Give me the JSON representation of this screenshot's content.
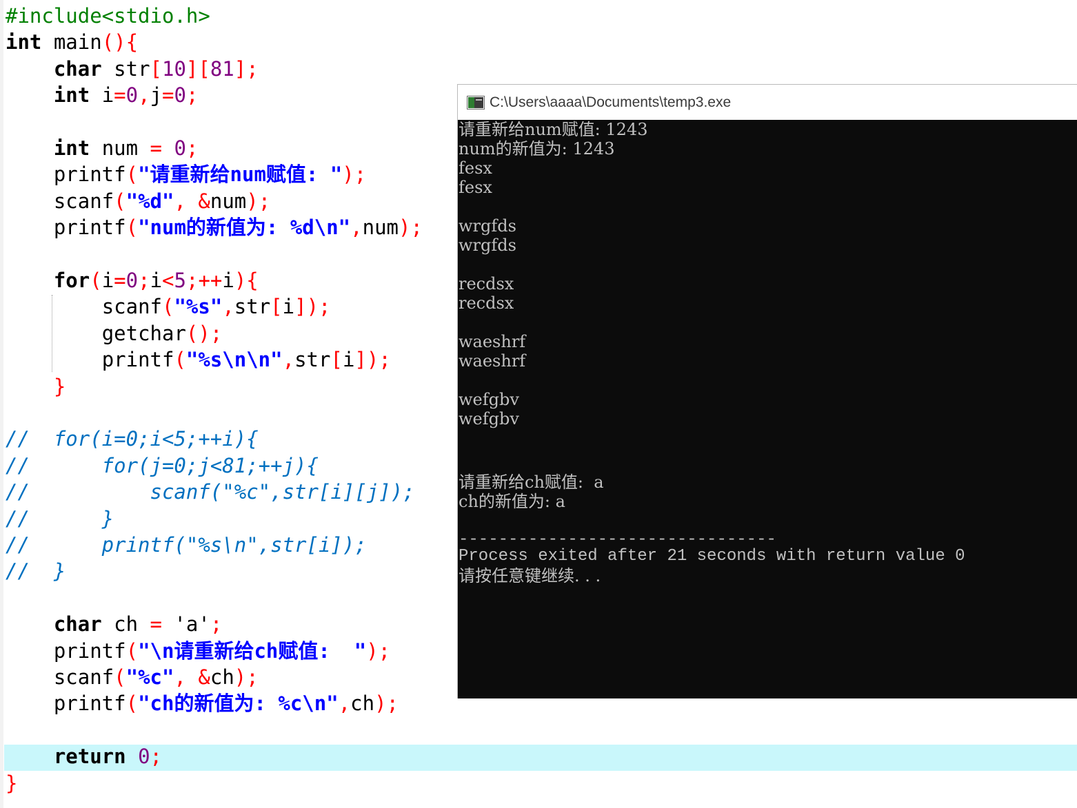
{
  "editor": {
    "lines": [
      {
        "tokens": [
          {
            "t": "#include<stdio.h>",
            "c": "pp"
          }
        ]
      },
      {
        "tokens": [
          {
            "t": "int",
            "c": "kw"
          },
          {
            "t": " main",
            "c": "id"
          },
          {
            "t": "(){",
            "c": "br"
          }
        ]
      },
      {
        "tokens": [
          {
            "t": "    "
          },
          {
            "t": "char",
            "c": "kw"
          },
          {
            "t": " str",
            "c": "id"
          },
          {
            "t": "[",
            "c": "br"
          },
          {
            "t": "10",
            "c": "num"
          },
          {
            "t": "][",
            "c": "br"
          },
          {
            "t": "81",
            "c": "num"
          },
          {
            "t": "];",
            "c": "br"
          }
        ]
      },
      {
        "tokens": [
          {
            "t": "    "
          },
          {
            "t": "int",
            "c": "kw"
          },
          {
            "t": " i",
            "c": "id"
          },
          {
            "t": "=",
            "c": "br"
          },
          {
            "t": "0",
            "c": "num"
          },
          {
            "t": ",",
            "c": "br"
          },
          {
            "t": "j",
            "c": "id"
          },
          {
            "t": "=",
            "c": "br"
          },
          {
            "t": "0",
            "c": "num"
          },
          {
            "t": ";",
            "c": "br"
          }
        ]
      },
      {
        "tokens": []
      },
      {
        "tokens": [
          {
            "t": "    "
          },
          {
            "t": "int",
            "c": "kw"
          },
          {
            "t": " num ",
            "c": "id"
          },
          {
            "t": "=",
            "c": "br"
          },
          {
            "t": " "
          },
          {
            "t": "0",
            "c": "num"
          },
          {
            "t": ";",
            "c": "br"
          }
        ]
      },
      {
        "tokens": [
          {
            "t": "    "
          },
          {
            "t": "printf",
            "c": "id"
          },
          {
            "t": "(",
            "c": "br"
          },
          {
            "t": "\"请重新给num赋值: \"",
            "c": "str"
          },
          {
            "t": ");",
            "c": "br"
          }
        ]
      },
      {
        "tokens": [
          {
            "t": "    "
          },
          {
            "t": "scanf",
            "c": "id"
          },
          {
            "t": "(",
            "c": "br"
          },
          {
            "t": "\"%d\"",
            "c": "str"
          },
          {
            "t": ",",
            "c": "br"
          },
          {
            "t": " "
          },
          {
            "t": "&",
            "c": "br"
          },
          {
            "t": "num",
            "c": "id"
          },
          {
            "t": ");",
            "c": "br"
          }
        ]
      },
      {
        "tokens": [
          {
            "t": "    "
          },
          {
            "t": "printf",
            "c": "id"
          },
          {
            "t": "(",
            "c": "br"
          },
          {
            "t": "\"num的新值为: %d\\n\"",
            "c": "str"
          },
          {
            "t": ",",
            "c": "br"
          },
          {
            "t": "num",
            "c": "id"
          },
          {
            "t": ");",
            "c": "br"
          }
        ]
      },
      {
        "tokens": []
      },
      {
        "tokens": [
          {
            "t": "    "
          },
          {
            "t": "for",
            "c": "kw"
          },
          {
            "t": "(",
            "c": "br"
          },
          {
            "t": "i",
            "c": "id"
          },
          {
            "t": "=",
            "c": "br"
          },
          {
            "t": "0",
            "c": "num"
          },
          {
            "t": ";",
            "c": "br"
          },
          {
            "t": "i",
            "c": "id"
          },
          {
            "t": "<",
            "c": "br"
          },
          {
            "t": "5",
            "c": "num"
          },
          {
            "t": ";++",
            "c": "br"
          },
          {
            "t": "i",
            "c": "id"
          },
          {
            "t": "){",
            "c": "br"
          }
        ]
      },
      {
        "tokens": [
          {
            "t": "        "
          },
          {
            "t": "scanf",
            "c": "id"
          },
          {
            "t": "(",
            "c": "br"
          },
          {
            "t": "\"%s\"",
            "c": "str"
          },
          {
            "t": ",",
            "c": "br"
          },
          {
            "t": "str",
            "c": "id"
          },
          {
            "t": "[",
            "c": "br"
          },
          {
            "t": "i",
            "c": "id"
          },
          {
            "t": "]);",
            "c": "br"
          }
        ]
      },
      {
        "tokens": [
          {
            "t": "        "
          },
          {
            "t": "getchar",
            "c": "id"
          },
          {
            "t": "();",
            "c": "br"
          }
        ]
      },
      {
        "tokens": [
          {
            "t": "        "
          },
          {
            "t": "printf",
            "c": "id"
          },
          {
            "t": "(",
            "c": "br"
          },
          {
            "t": "\"%s\\n\\n\"",
            "c": "str"
          },
          {
            "t": ",",
            "c": "br"
          },
          {
            "t": "str",
            "c": "id"
          },
          {
            "t": "[",
            "c": "br"
          },
          {
            "t": "i",
            "c": "id"
          },
          {
            "t": "]);",
            "c": "br"
          }
        ]
      },
      {
        "tokens": [
          {
            "t": "    "
          },
          {
            "t": "}",
            "c": "br"
          }
        ]
      },
      {
        "tokens": []
      },
      {
        "tokens": [
          {
            "t": "//  for(i=0;i<5;++i){",
            "c": "cm"
          }
        ]
      },
      {
        "tokens": [
          {
            "t": "//      for(j=0;j<81;++j){",
            "c": "cm"
          }
        ]
      },
      {
        "tokens": [
          {
            "t": "//          scanf(\"%c\",str[i][j]);",
            "c": "cm"
          }
        ]
      },
      {
        "tokens": [
          {
            "t": "//      }",
            "c": "cm"
          }
        ]
      },
      {
        "tokens": [
          {
            "t": "//      printf(\"%s\\n\",str[i]);",
            "c": "cm"
          }
        ]
      },
      {
        "tokens": [
          {
            "t": "//  }",
            "c": "cm"
          }
        ]
      },
      {
        "tokens": []
      },
      {
        "tokens": [
          {
            "t": "    "
          },
          {
            "t": "char",
            "c": "kw"
          },
          {
            "t": " ch ",
            "c": "id"
          },
          {
            "t": "=",
            "c": "br"
          },
          {
            "t": " 'a'",
            "c": "id"
          },
          {
            "t": ";",
            "c": "br"
          }
        ]
      },
      {
        "tokens": [
          {
            "t": "    "
          },
          {
            "t": "printf",
            "c": "id"
          },
          {
            "t": "(",
            "c": "br"
          },
          {
            "t": "\"\\n请重新给ch赋值:  \"",
            "c": "str"
          },
          {
            "t": ");",
            "c": "br"
          }
        ]
      },
      {
        "tokens": [
          {
            "t": "    "
          },
          {
            "t": "scanf",
            "c": "id"
          },
          {
            "t": "(",
            "c": "br"
          },
          {
            "t": "\"%c\"",
            "c": "str"
          },
          {
            "t": ",",
            "c": "br"
          },
          {
            "t": " "
          },
          {
            "t": "&",
            "c": "br"
          },
          {
            "t": "ch",
            "c": "id"
          },
          {
            "t": ");",
            "c": "br"
          }
        ]
      },
      {
        "tokens": [
          {
            "t": "    "
          },
          {
            "t": "printf",
            "c": "id"
          },
          {
            "t": "(",
            "c": "br"
          },
          {
            "t": "\"ch的新值为: %c\\n\"",
            "c": "str"
          },
          {
            "t": ",",
            "c": "br"
          },
          {
            "t": "ch",
            "c": "id"
          },
          {
            "t": ");",
            "c": "br"
          }
        ]
      },
      {
        "tokens": []
      },
      {
        "tokens": [
          {
            "t": "    "
          },
          {
            "t": "return",
            "c": "kw"
          },
          {
            "t": " "
          },
          {
            "t": "0",
            "c": "num"
          },
          {
            "t": ";",
            "c": "br"
          }
        ]
      },
      {
        "tokens": [
          {
            "t": "}",
            "c": "br"
          }
        ]
      }
    ]
  },
  "console": {
    "title": "C:\\Users\\aaaa\\Documents\\temp3.exe",
    "icon": "console-app-icon",
    "lines": [
      "请重新给num赋值: 1243",
      "num的新值为: 1243",
      "fesx",
      "fesx",
      "",
      "wrgfds",
      "wrgfds",
      "",
      "recdsx",
      "recdsx",
      "",
      "waeshrf",
      "waeshrf",
      "",
      "wefgbv",
      "wefgbv",
      "",
      "",
      "请重新给ch赋值:  a",
      "ch的新值为: a",
      "",
      "--------------------------------",
      "Process exited after 21 seconds with return value 0",
      "请按任意键继续. . ."
    ]
  },
  "colors": {
    "console_bg": "#0c0c0c",
    "console_text": "#c0c0c0",
    "current_line_highlight": "#c9f7fb"
  }
}
